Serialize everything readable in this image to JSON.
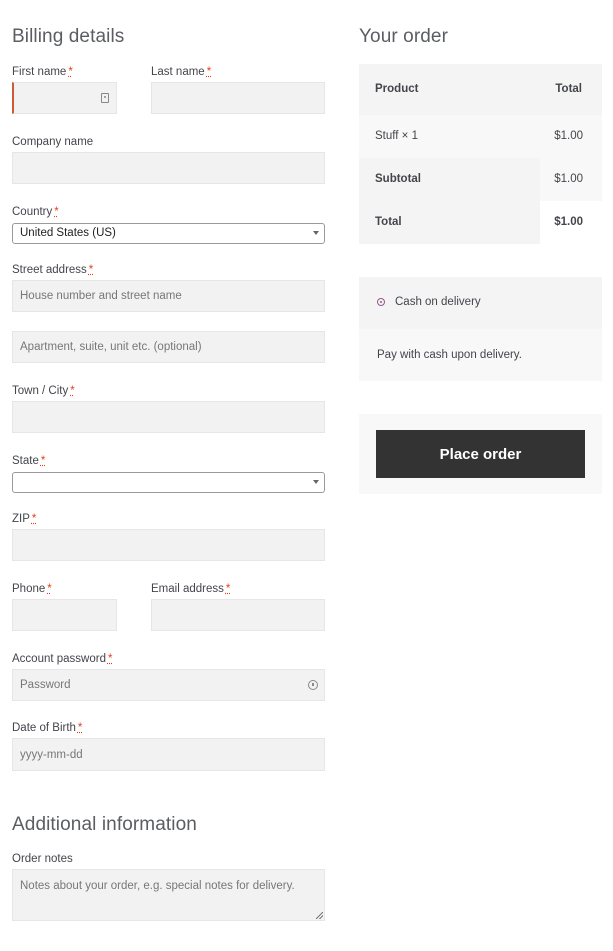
{
  "billing": {
    "title": "Billing details",
    "first_name": {
      "label": "First name",
      "req": "*",
      "value": ""
    },
    "last_name": {
      "label": "Last name",
      "req": "*",
      "value": ""
    },
    "company": {
      "label": "Company name",
      "value": ""
    },
    "country": {
      "label": "Country",
      "req": "*",
      "value": "United States (US)"
    },
    "street": {
      "label": "Street address",
      "req": "*",
      "placeholder1": "House number and street name",
      "placeholder2": "Apartment, suite, unit etc. (optional)"
    },
    "city": {
      "label": "Town / City",
      "req": "*"
    },
    "state": {
      "label": "State",
      "req": "*",
      "value": ""
    },
    "zip": {
      "label": "ZIP",
      "req": "*"
    },
    "phone": {
      "label": "Phone",
      "req": "*"
    },
    "email": {
      "label": "Email address",
      "req": "*"
    },
    "password": {
      "label": "Account password",
      "req": "*",
      "placeholder": "Password"
    },
    "dob": {
      "label": "Date of Birth",
      "req": "*",
      "placeholder": "yyyy-mm-dd"
    }
  },
  "additional": {
    "title": "Additional information",
    "notes": {
      "label": "Order notes",
      "placeholder": "Notes about your order, e.g. special notes for delivery."
    }
  },
  "order": {
    "title": "Your order",
    "header": {
      "product": "Product",
      "total": "Total"
    },
    "item": {
      "name": "Stuff",
      "qty": "× 1",
      "total": "$1.00"
    },
    "subtotal": {
      "label": "Subtotal",
      "value": "$1.00"
    },
    "total": {
      "label": "Total",
      "value": "$1.00"
    }
  },
  "payment": {
    "method": "Cash on delivery",
    "description": "Pay with cash upon delivery.",
    "accent": "#96588a"
  },
  "place_order": {
    "label": "Place order",
    "bg": "#333333"
  }
}
